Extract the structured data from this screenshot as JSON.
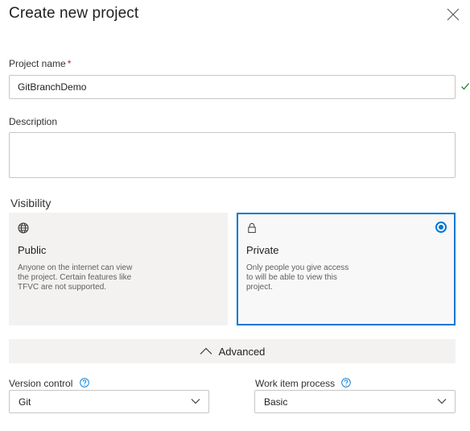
{
  "dialog": {
    "title": "Create new project"
  },
  "project_name": {
    "label": "Project name",
    "required_marker": "*",
    "value": "GitBranchDemo",
    "valid": true
  },
  "description": {
    "label": "Description",
    "value": "",
    "placeholder": ""
  },
  "visibility": {
    "label": "Visibility",
    "selected": "private",
    "options": [
      {
        "id": "public",
        "icon": "globe-icon",
        "title": "Public",
        "description": "Anyone on the internet can view the project. Certain features like TFVC are not supported."
      },
      {
        "id": "private",
        "icon": "lock-icon",
        "title": "Private",
        "description": "Only people you give access to will be able to view this project."
      }
    ]
  },
  "advanced": {
    "label": "Advanced",
    "expanded": true
  },
  "version_control": {
    "label": "Version control",
    "value": "Git"
  },
  "work_item_process": {
    "label": "Work item process",
    "value": "Basic"
  },
  "colors": {
    "accent": "#0078d4",
    "required": "#a4262c",
    "valid": "#107c10",
    "card_bg": "#f3f2f1"
  }
}
